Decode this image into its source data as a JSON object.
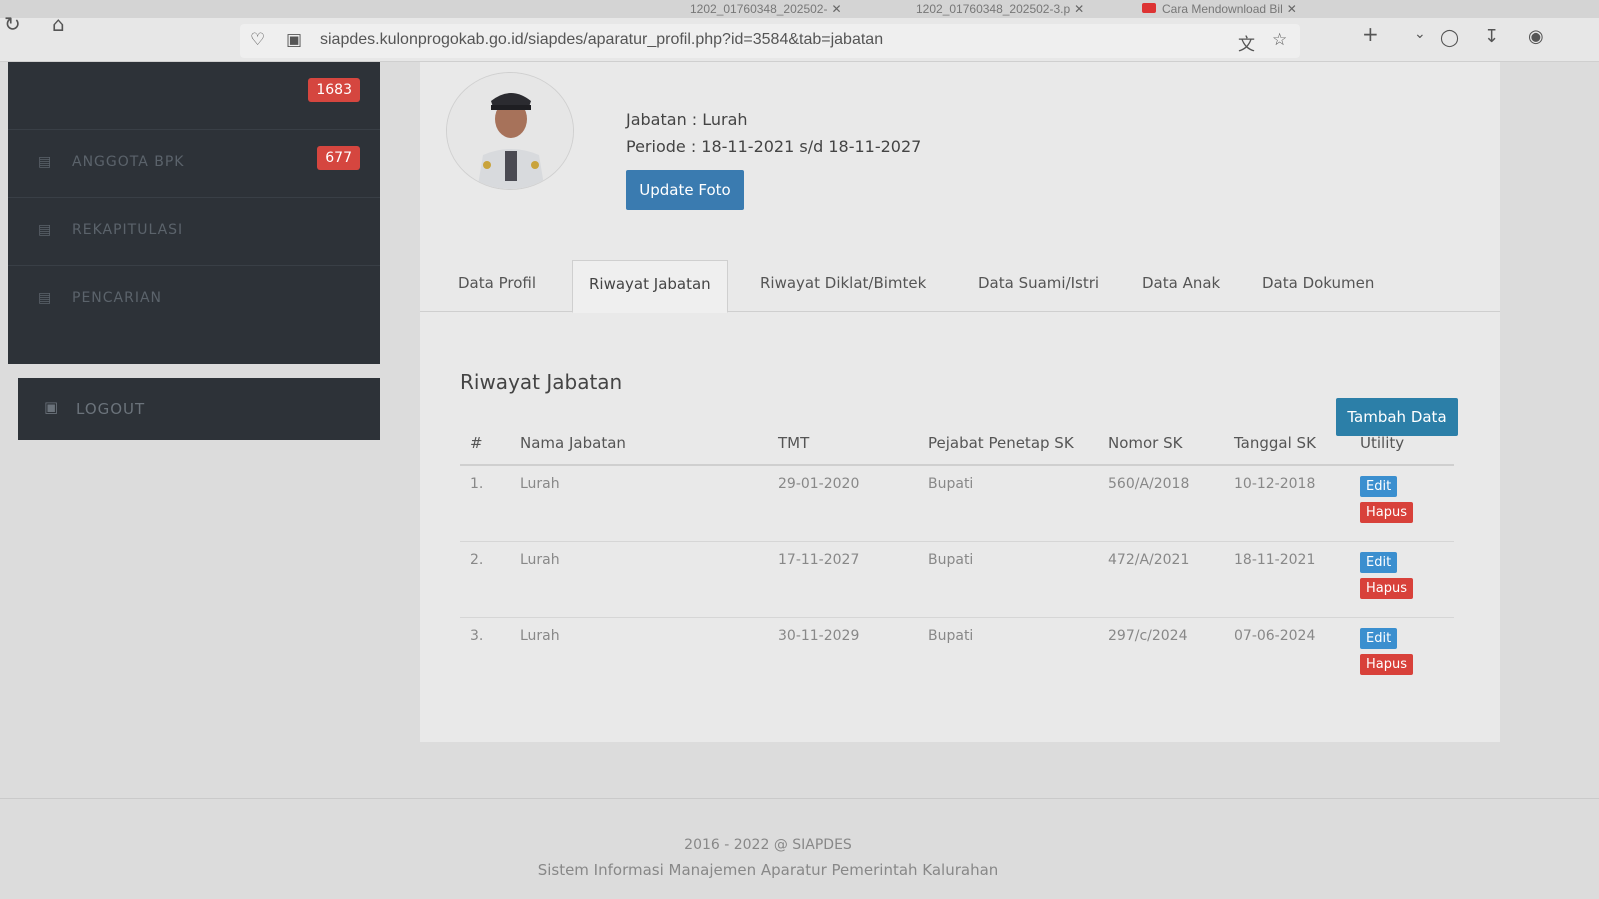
{
  "browser": {
    "tabs": [
      {
        "label": "1202_01760348_202502-"
      },
      {
        "label": "1202_01760348_202502-3.p"
      },
      {
        "label": "Cara Mendownload Bil"
      }
    ],
    "tab_close": "✕",
    "new_tab": "+",
    "url": "siapdes.kulonprogokab.go.id/siapdes/aparatur_profil.php?id=3584&tab=jabatan"
  },
  "sidebar": {
    "items": [
      {
        "label": "",
        "badge": "1683",
        "icon": "list-icon"
      },
      {
        "label": "ANGGOTA BPK",
        "badge": "677",
        "icon": "list-icon"
      },
      {
        "label": "REKAPITULASI",
        "badge": "",
        "icon": "list-icon"
      },
      {
        "label": "PENCARIAN",
        "badge": "",
        "icon": "list-icon"
      }
    ],
    "logout_label": "LOGOUT"
  },
  "profile": {
    "jabatan": "Jabatan : Lurah",
    "periode": "Periode : 18-11-2021 s/d 18-11-2027",
    "update_button": "Update Foto"
  },
  "tabs": [
    {
      "label": "Data Profil"
    },
    {
      "label": "Riwayat Jabatan"
    },
    {
      "label": "Riwayat Diklat/Bimtek"
    },
    {
      "label": "Data Suami/Istri"
    },
    {
      "label": "Data Anak"
    },
    {
      "label": "Data Dokumen"
    }
  ],
  "section": {
    "title": "Riwayat Jabatan",
    "add_button": "Tambah Data"
  },
  "table": {
    "headers": [
      "#",
      "Nama Jabatan",
      "TMT",
      "Pejabat Penetap SK",
      "Nomor SK",
      "Tanggal SK",
      "Utility"
    ],
    "rows": [
      {
        "no": "1.",
        "nama": "Lurah",
        "tmt": "29-01-2020",
        "pejabat": "Bupati",
        "nomor": "560/A/2018",
        "tanggal": "10-12-2018"
      },
      {
        "no": "2.",
        "nama": "Lurah",
        "tmt": "17-11-2027",
        "pejabat": "Bupati",
        "nomor": "472/A/2021",
        "tanggal": "18-11-2021"
      },
      {
        "no": "3.",
        "nama": "Lurah",
        "tmt": "30-11-2029",
        "pejabat": "Bupati",
        "nomor": "297/c/2024",
        "tanggal": "07-06-2024"
      }
    ],
    "edit_label": "Edit",
    "delete_label": "Hapus"
  },
  "footer": {
    "copyright": "2016 - 2022 @ SIAPDES",
    "tagline": "Sistem Informasi Manajemen Aparatur Pemerintah Kalurahan"
  }
}
